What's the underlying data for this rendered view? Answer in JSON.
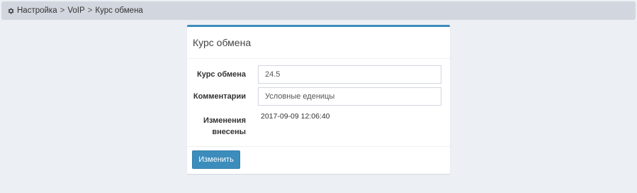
{
  "breadcrumb": {
    "items": [
      "Настройка",
      "VoIP",
      "Курс обмена"
    ],
    "separator": ">"
  },
  "panel": {
    "title": "Курс обмена",
    "fields": {
      "rate_label": "Курс обмена",
      "rate_value": "24.5",
      "comment_label": "Комментарии",
      "comment_value": "Условные еденицы",
      "changed_label_line1": "Изменения",
      "changed_label_line2": "внесены",
      "changed_value": "2017-09-09 12:06:40"
    },
    "submit_label": "Изменить"
  },
  "colors": {
    "accent": "#3c8dbc",
    "page_background": "#ecf0f5",
    "breadcrumb_background": "#d2d6de"
  },
  "icons": {
    "breadcrumb": "gear-icon"
  }
}
